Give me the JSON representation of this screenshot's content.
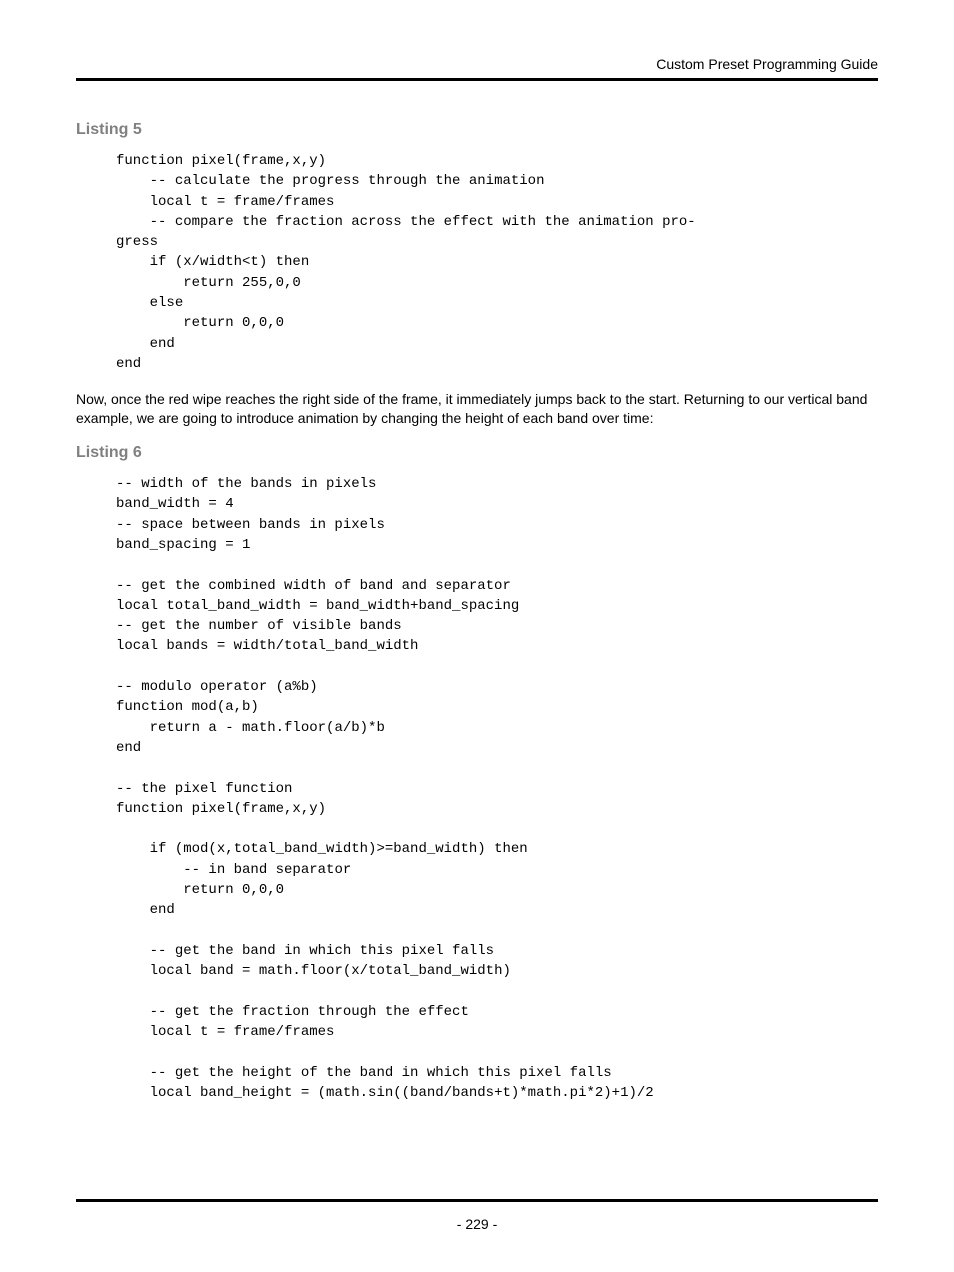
{
  "header": {
    "title": "Custom Preset Programming Guide"
  },
  "content": {
    "listing5_heading": "Listing 5",
    "listing5_code": "function pixel(frame,x,y)\n    -- calculate the progress through the animation\n    local t = frame/frames\n    -- compare the fraction across the effect with the animation pro-\ngress\n    if (x/width<t) then\n        return 255,0,0\n    else\n        return 0,0,0\n    end\nend",
    "paragraph1": "Now, once the red wipe reaches the right side of the frame, it immediately jumps back to the start. Returning to our vertical band example, we are going to introduce animation by changing the height of each band over time:",
    "listing6_heading": "Listing 6",
    "listing6_code": "-- width of the bands in pixels\nband_width = 4\n-- space between bands in pixels\nband_spacing = 1\n\n-- get the combined width of band and separator\nlocal total_band_width = band_width+band_spacing\n-- get the number of visible bands\nlocal bands = width/total_band_width\n\n-- modulo operator (a%b)\nfunction mod(a,b)\n    return a - math.floor(a/b)*b\nend\n\n-- the pixel function\nfunction pixel(frame,x,y)\n\n    if (mod(x,total_band_width)>=band_width) then\n        -- in band separator\n        return 0,0,0\n    end\n\n    -- get the band in which this pixel falls\n    local band = math.floor(x/total_band_width)\n\n    -- get the fraction through the effect\n    local t = frame/frames\n\n    -- get the height of the band in which this pixel falls\n    local band_height = (math.sin((band/bands+t)*math.pi*2)+1)/2"
  },
  "footer": {
    "page_number": "- 229 -"
  }
}
